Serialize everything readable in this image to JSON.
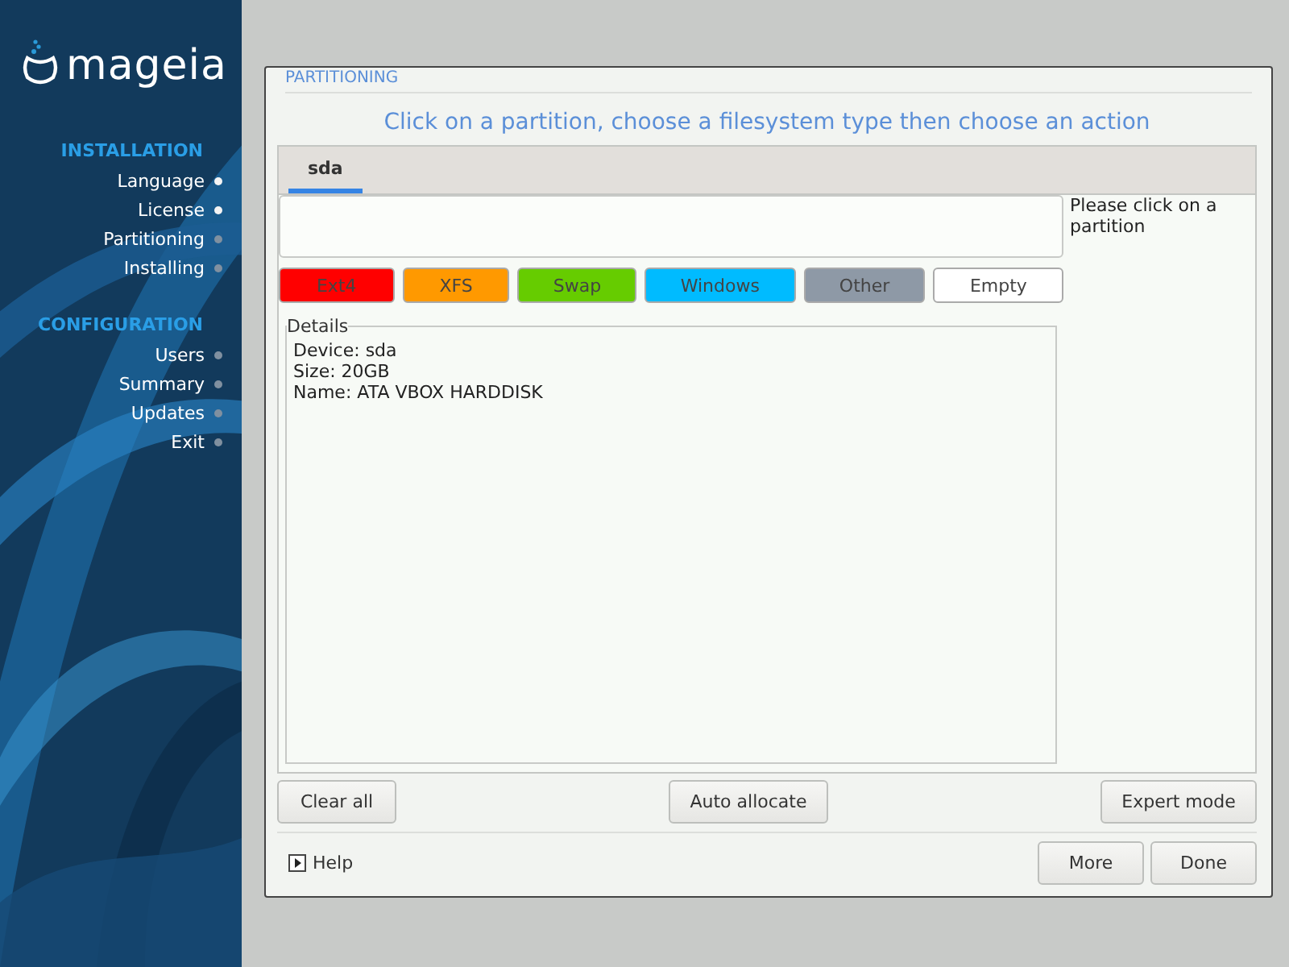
{
  "sidebar": {
    "logo": "mageia",
    "sections": [
      {
        "title": "INSTALLATION",
        "steps": [
          {
            "label": "Language",
            "done": true
          },
          {
            "label": "License",
            "done": true
          },
          {
            "label": "Partitioning",
            "done": false
          },
          {
            "label": "Installing",
            "done": false
          }
        ]
      },
      {
        "title": "CONFIGURATION",
        "steps": [
          {
            "label": "Users",
            "done": false
          },
          {
            "label": "Summary",
            "done": false
          },
          {
            "label": "Updates",
            "done": false
          },
          {
            "label": "Exit",
            "done": false
          }
        ]
      }
    ]
  },
  "dialog": {
    "title": "PARTITIONING",
    "instruction": "Click on a partition, choose a filesystem type then choose an action",
    "tabs": [
      {
        "label": "sda",
        "selected": true
      }
    ],
    "hint": "Please click on a partition",
    "legend": [
      {
        "label": "Ext4",
        "color": "#ff0000"
      },
      {
        "label": "XFS",
        "color": "#ff9900"
      },
      {
        "label": "Swap",
        "color": "#66cc00"
      },
      {
        "label": "Windows",
        "color": "#00bbff"
      },
      {
        "label": "Other",
        "color": "#8e99a6"
      },
      {
        "label": "Empty",
        "color": "#ffffff"
      }
    ],
    "details": {
      "title": "Details",
      "lines": [
        "Device: sda",
        "Size: 20GB",
        "Name: ATA VBOX HARDDISK"
      ]
    },
    "actions": [
      "Clear all",
      "Auto allocate",
      "Expert mode"
    ],
    "help": "Help",
    "buttons": [
      "More",
      "Done"
    ]
  }
}
